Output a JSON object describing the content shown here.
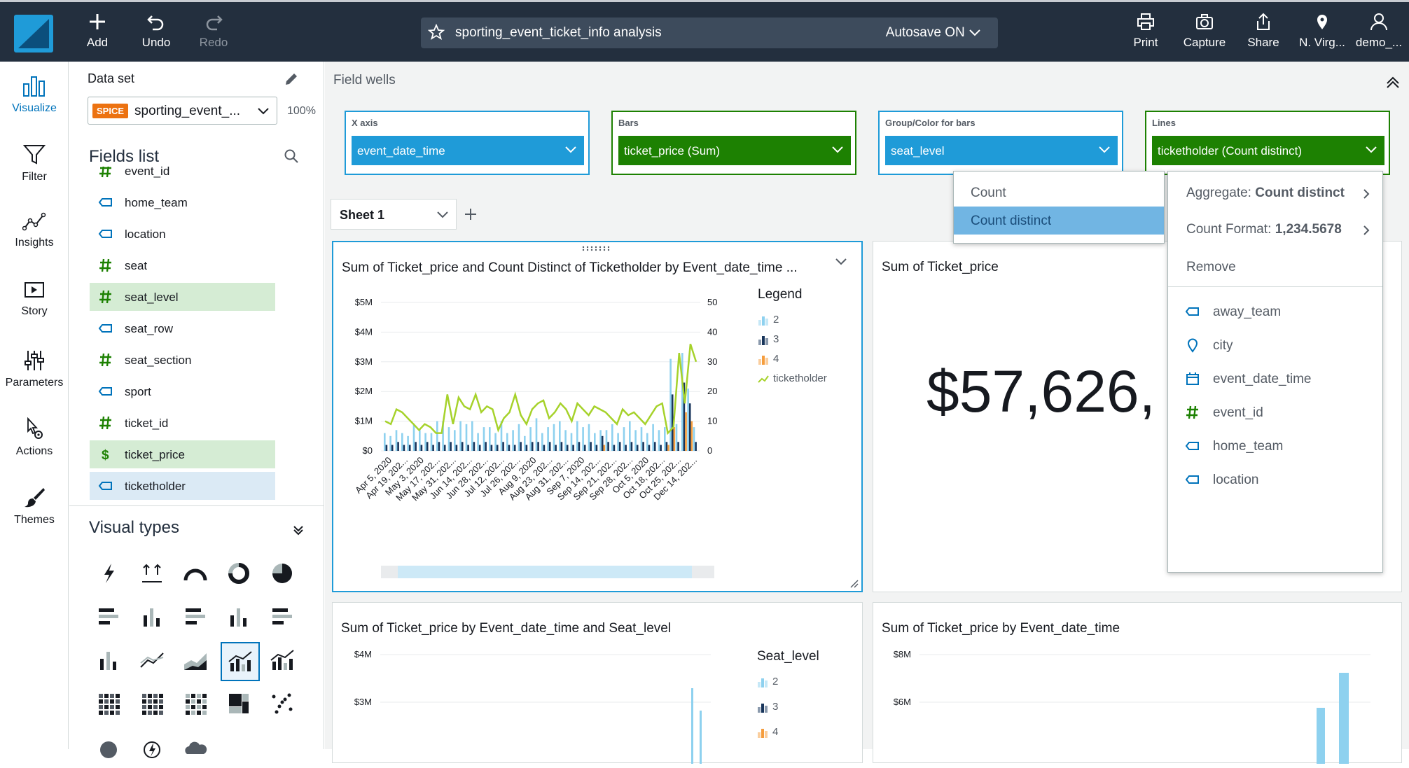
{
  "toolbar": {
    "add": "Add",
    "undo": "Undo",
    "redo": "Redo",
    "analysis_title": "sporting_event_ticket_info analysis",
    "autosave": "Autosave ON",
    "print": "Print",
    "capture": "Capture",
    "share": "Share",
    "region": "N. Virg...",
    "user": "demo_..."
  },
  "rail": {
    "visualize": "Visualize",
    "filter": "Filter",
    "insights": "Insights",
    "story": "Story",
    "parameters": "Parameters",
    "actions": "Actions",
    "themes": "Themes"
  },
  "dataset": {
    "label": "Data set",
    "badge": "SPICE",
    "name": "sporting_event_...",
    "percent": "100%"
  },
  "fields_list": {
    "title": "Fields list",
    "items": [
      {
        "name": "event_id",
        "type": "number",
        "state": "none"
      },
      {
        "name": "home_team",
        "type": "string",
        "state": "none"
      },
      {
        "name": "location",
        "type": "string",
        "state": "none"
      },
      {
        "name": "seat",
        "type": "number",
        "state": "none"
      },
      {
        "name": "seat_level",
        "type": "number",
        "state": "used"
      },
      {
        "name": "seat_row",
        "type": "string",
        "state": "none"
      },
      {
        "name": "seat_section",
        "type": "number",
        "state": "none"
      },
      {
        "name": "sport",
        "type": "string",
        "state": "none"
      },
      {
        "name": "ticket_id",
        "type": "number",
        "state": "none"
      },
      {
        "name": "ticket_price",
        "type": "currency",
        "state": "used"
      },
      {
        "name": "ticketholder",
        "type": "string",
        "state": "selected"
      }
    ]
  },
  "visual_types": {
    "title": "Visual types"
  },
  "field_wells": {
    "title": "Field wells",
    "wells": [
      {
        "label": "X axis",
        "value": "event_date_time",
        "color": "blue"
      },
      {
        "label": "Bars",
        "value": "ticket_price (Sum)",
        "color": "green"
      },
      {
        "label": "Group/Color for bars",
        "value": "seat_level",
        "color": "blue"
      },
      {
        "label": "Lines",
        "value": "ticketholder (Count distinct)",
        "color": "green"
      }
    ]
  },
  "sheet": {
    "tab": "Sheet 1"
  },
  "aggregate_menu": {
    "items": [
      "Count",
      "Count distinct"
    ],
    "selected": "Count distinct"
  },
  "field_menu": {
    "aggregate_label": "Aggregate: ",
    "aggregate_value": "Count distinct",
    "format_label": "Count Format: ",
    "format_value": "1,234.5678",
    "remove": "Remove",
    "fields": [
      {
        "name": "away_team",
        "type": "string"
      },
      {
        "name": "city",
        "type": "geo"
      },
      {
        "name": "event_date_time",
        "type": "date"
      },
      {
        "name": "event_id",
        "type": "number"
      },
      {
        "name": "home_team",
        "type": "string"
      },
      {
        "name": "location",
        "type": "string"
      }
    ]
  },
  "cards": {
    "combo": {
      "title": "Sum of Ticket_price and Count Distinct of Ticketholder by Event_date_time ..."
    },
    "kpi": {
      "title": "Sum of Ticket_price",
      "value": "$57,626,"
    },
    "bottom_left": {
      "title": "Sum of Ticket_price by Event_date_time and Seat_level",
      "legend_title": "Seat_level"
    },
    "bottom_right": {
      "title": "Sum of Ticket_price by Event_date_time"
    }
  },
  "colors": {
    "seat_2": "#8ed1ef",
    "seat_3": "#18355b",
    "seat_4": "#f59d3d",
    "line": "#a6d22b",
    "accent": "#1f9bd8",
    "green": "#1d8102"
  },
  "chart_data": [
    {
      "type": "bar",
      "title": "Sum of Ticket_price and Count Distinct of Ticketholder by Event_date_time ...",
      "legend_title": "Legend",
      "legend_position": "right",
      "x_tick_labels": [
        "Apr 5, 2020",
        "Apr 19, 202...",
        "May 3, 2020",
        "May 17, 202...",
        "May 31, 202...",
        "Jun 14, 202...",
        "Jun 28, 202...",
        "Jul 12, 202...",
        "Jul 26, 202...",
        "Aug 9, 2020",
        "Aug 23, 202...",
        "Aug 31, 202...",
        "Sep 7, 2020",
        "Sep 14, 202...",
        "Sep 21, 202...",
        "Sep 28, 202...",
        "Oct 5, 2020",
        "Oct 18, 202...",
        "Oct 25, 202...",
        "Dec 14, 202..."
      ],
      "y_left": {
        "ticks": [
          "$0",
          "$1M",
          "$2M",
          "$3M",
          "$4M",
          "$5M"
        ],
        "range": [
          0,
          5
        ]
      },
      "y_right": {
        "ticks": [
          "0",
          "10",
          "20",
          "30",
          "40",
          "50"
        ],
        "range": [
          0,
          50
        ]
      },
      "series": [
        {
          "name": "2",
          "kind": "bar",
          "values": [
            0.6,
            0.5,
            0.7,
            0.6,
            0.5,
            0.9,
            0.7,
            0.6,
            0.6,
            1.0,
            1.0,
            0.8,
            0.7,
            1.0,
            0.9,
            1.0,
            0.6,
            0.8,
            0.8,
            0.6,
            1.0,
            0.6,
            0.7,
            0.9,
            0.5,
            0.8,
            1.1,
            0.6,
            0.8,
            0.9,
            1.0,
            0.7,
            0.6,
            1.0,
            0.8,
            0.9,
            0.6,
            0.7,
            0.7,
            0.9,
            0.6,
            0.8,
            1.0,
            0.7,
            0.8,
            0.6,
            0.9,
            0.7,
            0.8,
            3.1,
            0.9,
            3.3,
            2.1,
            0.8
          ]
        },
        {
          "name": "3",
          "kind": "bar",
          "values": [
            0.2,
            0.2,
            0.3,
            0.2,
            0.2,
            0.3,
            0.2,
            0.3,
            0.2,
            0.3,
            0.2,
            0.3,
            0.2,
            0.3,
            0.2,
            0.3,
            0.2,
            0.3,
            0.2,
            0.2,
            0.3,
            0.2,
            0.2,
            0.3,
            0.2,
            0.3,
            0.3,
            0.2,
            0.3,
            0.2,
            0.3,
            0.2,
            0.2,
            0.3,
            0.2,
            0.3,
            0.2,
            0.5,
            0.3,
            0.2,
            0.3,
            0.2,
            0.3,
            0.2,
            0.3,
            0.2,
            0.3,
            0.2,
            0.3,
            1.9,
            0.3,
            2.3,
            1.6,
            0.3
          ]
        },
        {
          "name": "4",
          "kind": "bar",
          "values": [
            0,
            0,
            0,
            0,
            0,
            0,
            0,
            0,
            0,
            0,
            0,
            0,
            0,
            0,
            0,
            0,
            0,
            0,
            0,
            0,
            0,
            0,
            0,
            0,
            0,
            0,
            0,
            0,
            0,
            0,
            0,
            0,
            0,
            0,
            0,
            0,
            0,
            0.2,
            0,
            0,
            0,
            0,
            0,
            0,
            0,
            0,
            0,
            0,
            0.2,
            0.8,
            0,
            1.3,
            1.0,
            0
          ]
        },
        {
          "name": "ticketholder",
          "kind": "line",
          "values": [
            10,
            9,
            14,
            13,
            11,
            9,
            7,
            9,
            8,
            6,
            6,
            19,
            9,
            18,
            15,
            14,
            19,
            13,
            15,
            14,
            7,
            11,
            13,
            19,
            12,
            9,
            14,
            16,
            17,
            11,
            13,
            16,
            14,
            10,
            16,
            14,
            12,
            15,
            14,
            13,
            11,
            9,
            14,
            12,
            13,
            11,
            9,
            12,
            15,
            16,
            6,
            8,
            33,
            16,
            36,
            30
          ]
        }
      ]
    },
    {
      "type": "bar",
      "title": "Sum of Ticket_price by Event_date_time and Seat_level",
      "legend_title": "Seat_level",
      "legend": [
        "2",
        "3",
        "4"
      ],
      "y_ticks": [
        "$3M",
        "$4M"
      ]
    },
    {
      "type": "bar",
      "title": "Sum of Ticket_price by Event_date_time",
      "y_ticks": [
        "$6M",
        "$8M"
      ]
    }
  ]
}
